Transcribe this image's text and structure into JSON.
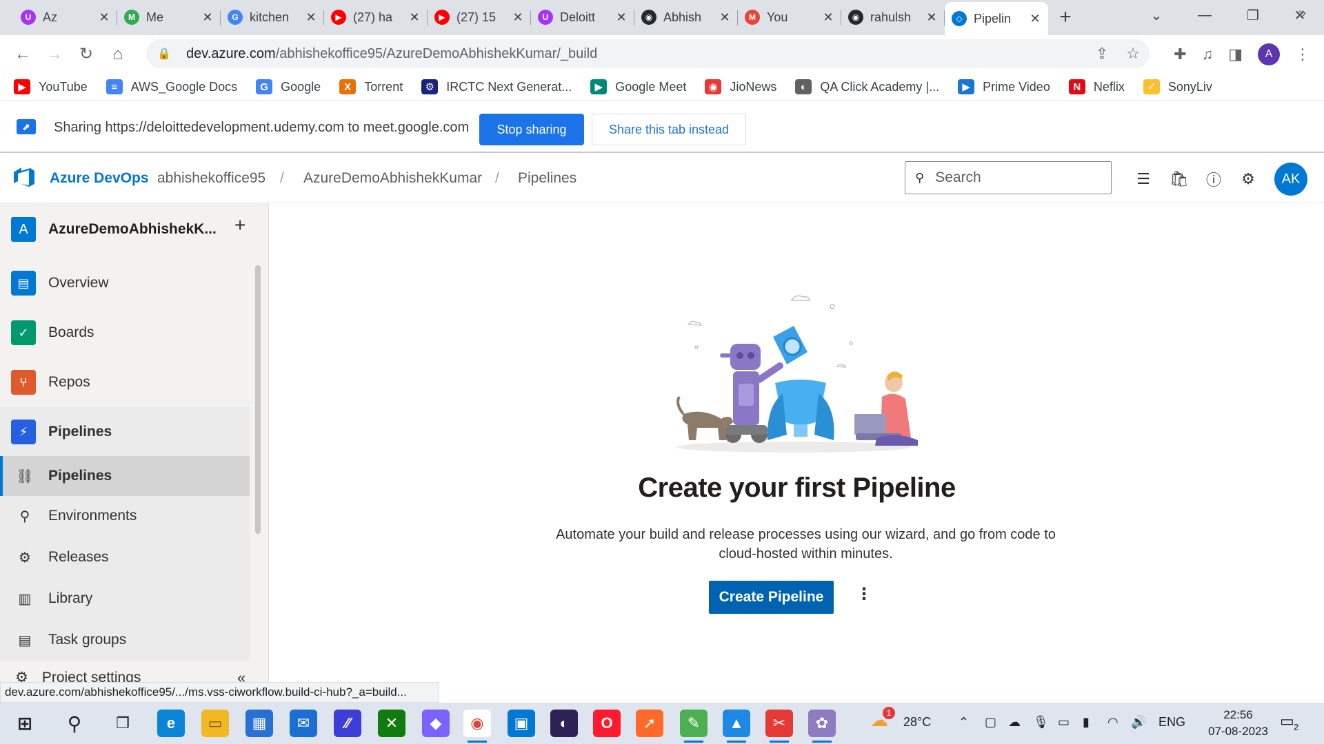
{
  "browser": {
    "tabs": [
      {
        "title": "Az",
        "color": "#a435f0",
        "glyph": "U"
      },
      {
        "title": "Me",
        "color": "#34a853",
        "glyph": "M"
      },
      {
        "title": "kitchen",
        "color": "#4285f4",
        "glyph": "G"
      },
      {
        "title": "(27) ha",
        "color": "#ff0000",
        "glyph": "▶"
      },
      {
        "title": "(27) 15",
        "color": "#ff0000",
        "glyph": "▶"
      },
      {
        "title": "Deloitt",
        "color": "#a435f0",
        "glyph": "U"
      },
      {
        "title": "Abhish",
        "color": "#24292f",
        "glyph": "◉"
      },
      {
        "title": "You",
        "color": "#ea4335",
        "glyph": "M"
      },
      {
        "title": "rahulsh",
        "color": "#24292f",
        "glyph": "◉"
      },
      {
        "title": "Pipelin",
        "color": "#0078d4",
        "glyph": "◇",
        "active": true
      }
    ],
    "url_host": "dev.azure.com",
    "url_path": "/abhishekoffice95/AzureDemoAbhishekKumar/_build",
    "profile_initial": "A",
    "bookmarks": [
      {
        "label": "YouTube",
        "color": "#ff0000",
        "glyph": "▶"
      },
      {
        "label": "AWS_Google Docs",
        "color": "#4285f4",
        "glyph": "≡"
      },
      {
        "label": "Google",
        "color": "#4285f4",
        "glyph": "G"
      },
      {
        "label": "Torrent",
        "color": "#e8710a",
        "glyph": "X"
      },
      {
        "label": "IRCTC Next Generat...",
        "color": "#1a237e",
        "glyph": "⚙"
      },
      {
        "label": "Google Meet",
        "color": "#00897b",
        "glyph": "▶"
      },
      {
        "label": "JioNews",
        "color": "#e53935",
        "glyph": "◉"
      },
      {
        "label": "QA Click Academy |...",
        "color": "#616161",
        "glyph": "◐"
      },
      {
        "label": "Prime Video",
        "color": "#1976d2",
        "glyph": "▶"
      },
      {
        "label": "Neflix",
        "color": "#e50914",
        "glyph": "N"
      },
      {
        "label": "SonyLiv",
        "color": "#fbc02d",
        "glyph": "✓"
      }
    ],
    "bookmarks_more": "»"
  },
  "sharing": {
    "text": "Sharing https://deloittedevelopment.udemy.com to meet.google.com",
    "stop_label": "Stop sharing",
    "share_tab_label": "Share this tab instead"
  },
  "ado": {
    "brand": "Azure DevOps",
    "breadcrumb": [
      "abhishekoffice95",
      "AzureDemoAbhishekKumar",
      "Pipelines"
    ],
    "separator": "/",
    "search_placeholder": "Search",
    "user_initials": "AK"
  },
  "sidebar": {
    "project_initial": "A",
    "project_name": "AzureDemoAbhishekK...",
    "add_label": "+",
    "items": [
      {
        "label": "Overview",
        "color": "#0078d4"
      },
      {
        "label": "Boards",
        "color": "#009a6e"
      },
      {
        "label": "Repos",
        "color": "#e05b2b"
      },
      {
        "label": "Pipelines",
        "color": "#2560e0"
      }
    ],
    "sub_items": [
      {
        "label": "Pipelines",
        "icon": "⛓"
      },
      {
        "label": "Environments",
        "icon": "⚲"
      },
      {
        "label": "Releases",
        "icon": "⚙"
      },
      {
        "label": "Library",
        "icon": "▥"
      },
      {
        "label": "Task groups",
        "icon": "▤"
      }
    ],
    "settings_label": "Project settings",
    "collapse_label": "«"
  },
  "status_url": "dev.azure.com/abhishekoffice95/.../ms.vss-ciworkflow.build-ci-hub?_a=build...",
  "main": {
    "title": "Create your first Pipeline",
    "description": "Automate your build and release processes using our wizard, and go from code to cloud-hosted within minutes.",
    "create_label": "Create Pipeline",
    "more_label": "⋮"
  },
  "taskbar": {
    "weather": "28°C",
    "weather_badge": "1",
    "language": "ENG",
    "time": "22:56",
    "date": "07-08-2023",
    "notif_count": "2"
  }
}
